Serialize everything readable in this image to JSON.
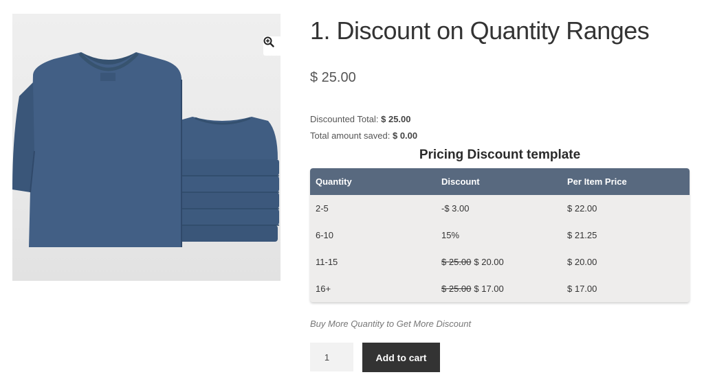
{
  "product": {
    "title": "1. Discount on Quantity Ranges",
    "price": "$ 25.00",
    "image_alt": "folded blue t-shirts stack",
    "shirt_color": "#3e5b80"
  },
  "totals": {
    "discounted_label": "Discounted Total:",
    "discounted_value": "$ 25.00",
    "saved_label": "Total amount saved:",
    "saved_value": "$ 0.00"
  },
  "pricing_table": {
    "title": "Pricing Discount template",
    "headers": [
      "Quantity",
      "Discount",
      "Per Item Price"
    ],
    "rows": [
      {
        "quantity": "2-5",
        "discount_old": "",
        "discount": "-$ 3.00",
        "price": "$ 22.00"
      },
      {
        "quantity": "6-10",
        "discount_old": "",
        "discount": "15%",
        "price": "$ 21.25"
      },
      {
        "quantity": "11-15",
        "discount_old": "$ 25.00",
        "discount": "$ 20.00",
        "price": "$ 20.00"
      },
      {
        "quantity": "16+",
        "discount_old": "$ 25.00",
        "discount": "$ 17.00",
        "price": "$ 17.00"
      }
    ],
    "header_color": "#58697f"
  },
  "promo_note": "Buy More Quantity to Get More Discount",
  "cart": {
    "quantity": "1",
    "add_button": "Add to cart"
  },
  "icons": {
    "zoom": "zoom-in-icon"
  }
}
